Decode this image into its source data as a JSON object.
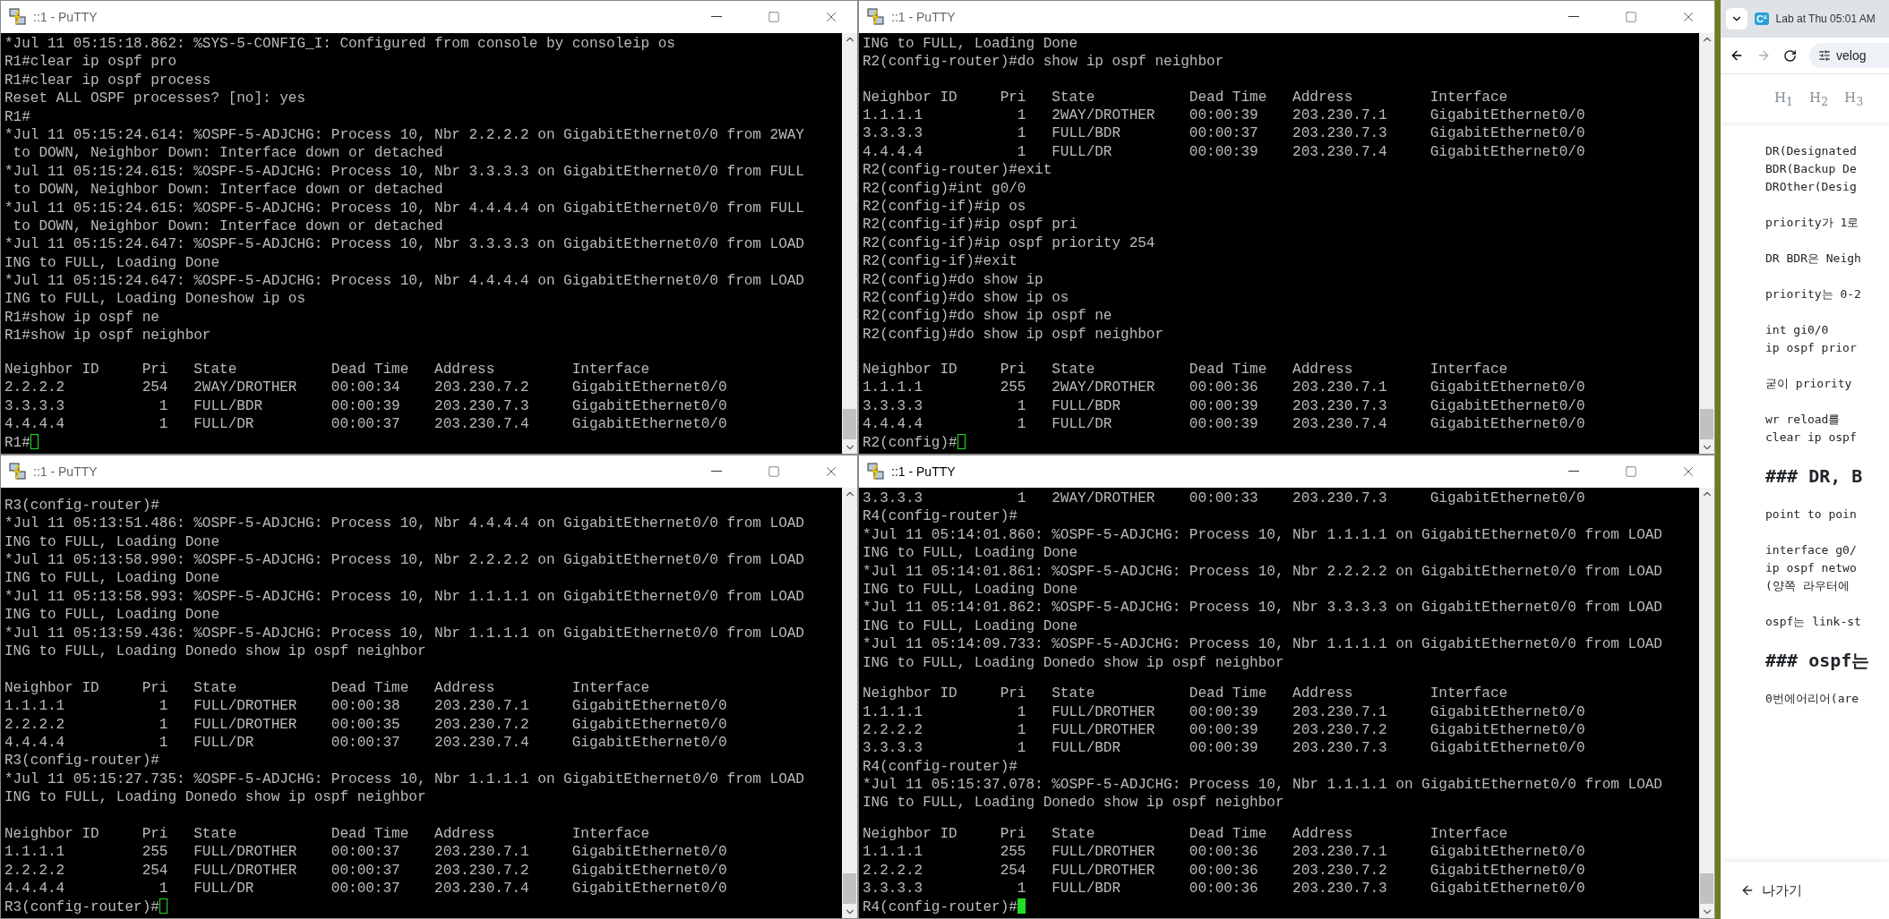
{
  "windows": [
    {
      "title": "::1 - PuTTY",
      "focused": false,
      "blocks": [
        [
          "*Jul 11 05:15:18.862: %SYS-5-CONFIG_I: Configured from console by consoleip os",
          "R1#clear ip ospf pro",
          "R1#clear ip ospf process",
          "Reset ALL OSPF processes? [no]: yes",
          "R1#",
          "*Jul 11 05:15:24.614: %OSPF-5-ADJCHG: Process 10, Nbr 2.2.2.2 on GigabitEthernet0/0 from 2WAY",
          " to DOWN, Neighbor Down: Interface down or detached",
          "*Jul 11 05:15:24.615: %OSPF-5-ADJCHG: Process 10, Nbr 3.3.3.3 on GigabitEthernet0/0 from FULL",
          " to DOWN, Neighbor Down: Interface down or detached",
          "*Jul 11 05:15:24.615: %OSPF-5-ADJCHG: Process 10, Nbr 4.4.4.4 on GigabitEthernet0/0 from FULL",
          " to DOWN, Neighbor Down: Interface down or detached",
          "*Jul 11 05:15:24.647: %OSPF-5-ADJCHG: Process 10, Nbr 3.3.3.3 on GigabitEthernet0/0 from LOAD",
          "ING to FULL, Loading Done",
          "*Jul 11 05:15:24.647: %OSPF-5-ADJCHG: Process 10, Nbr 4.4.4.4 on GigabitEthernet0/0 from LOAD",
          "ING to FULL, Loading Doneshow ip os",
          "R1#show ip ospf ne",
          "R1#show ip ospf neighbor"
        ],
        [
          "Neighbor ID     Pri   State           Dead Time   Address         Interface",
          "2.2.2.2         254   2WAY/DROTHER    00:00:34    203.230.7.2     GigabitEthernet0/0",
          "3.3.3.3           1   FULL/BDR        00:00:39    203.230.7.3     GigabitEthernet0/0",
          "4.4.4.4           1   FULL/DR         00:00:37    203.230.7.4     GigabitEthernet0/0",
          "R1#"
        ]
      ]
    },
    {
      "title": "::1 - PuTTY",
      "focused": false,
      "blocks": [
        [
          "ING to FULL, Loading Done",
          "R2(config-router)#do show ip ospf neighbor"
        ],
        [
          "Neighbor ID     Pri   State           Dead Time   Address         Interface",
          "1.1.1.1           1   2WAY/DROTHER    00:00:39    203.230.7.1     GigabitEthernet0/0",
          "3.3.3.3           1   FULL/BDR        00:00:37    203.230.7.3     GigabitEthernet0/0",
          "4.4.4.4           1   FULL/DR         00:00:39    203.230.7.4     GigabitEthernet0/0",
          "R2(config-router)#exit",
          "R2(config)#int g0/0",
          "R2(config-if)#ip os",
          "R2(config-if)#ip ospf pri",
          "R2(config-if)#ip ospf priority 254",
          "R2(config-if)#exit",
          "R2(config)#do show ip",
          "R2(config)#do show ip os",
          "R2(config)#do show ip ospf ne",
          "R2(config)#do show ip ospf neighbor"
        ],
        [
          "Neighbor ID     Pri   State           Dead Time   Address         Interface",
          "1.1.1.1         255   2WAY/DROTHER    00:00:36    203.230.7.1     GigabitEthernet0/0",
          "3.3.3.3           1   FULL/BDR        00:00:39    203.230.7.3     GigabitEthernet0/0",
          "4.4.4.4           1   FULL/DR         00:00:39    203.230.7.4     GigabitEthernet0/0",
          "R2(config)#"
        ]
      ]
    },
    {
      "title": "::1 - PuTTY",
      "focused": false,
      "blocks": [
        [
          "R3(config-router)#",
          "*Jul 11 05:13:51.486: %OSPF-5-ADJCHG: Process 10, Nbr 4.4.4.4 on GigabitEthernet0/0 from LOAD",
          "ING to FULL, Loading Done",
          "*Jul 11 05:13:58.990: %OSPF-5-ADJCHG: Process 10, Nbr 2.2.2.2 on GigabitEthernet0/0 from LOAD",
          "ING to FULL, Loading Done",
          "*Jul 11 05:13:58.993: %OSPF-5-ADJCHG: Process 10, Nbr 1.1.1.1 on GigabitEthernet0/0 from LOAD",
          "ING to FULL, Loading Done",
          "*Jul 11 05:13:59.436: %OSPF-5-ADJCHG: Process 10, Nbr 1.1.1.1 on GigabitEthernet0/0 from LOAD",
          "ING to FULL, Loading Donedo show ip ospf neighbor"
        ],
        [
          "Neighbor ID     Pri   State           Dead Time   Address         Interface",
          "1.1.1.1           1   FULL/DROTHER    00:00:38    203.230.7.1     GigabitEthernet0/0",
          "2.2.2.2           1   FULL/DROTHER    00:00:35    203.230.7.2     GigabitEthernet0/0",
          "4.4.4.4           1   FULL/DR         00:00:37    203.230.7.4     GigabitEthernet0/0",
          "R3(config-router)#",
          "*Jul 11 05:15:27.735: %OSPF-5-ADJCHG: Process 10, Nbr 1.1.1.1 on GigabitEthernet0/0 from LOAD",
          "ING to FULL, Loading Donedo show ip ospf neighbor"
        ],
        [
          "Neighbor ID     Pri   State           Dead Time   Address         Interface",
          "1.1.1.1         255   FULL/DROTHER    00:00:37    203.230.7.1     GigabitEthernet0/0",
          "2.2.2.2         254   FULL/DROTHER    00:00:37    203.230.7.2     GigabitEthernet0/0",
          "4.4.4.4           1   FULL/DR         00:00:37    203.230.7.4     GigabitEthernet0/0",
          "R3(config-router)#"
        ]
      ]
    },
    {
      "title": "::1 - PuTTY",
      "focused": true,
      "blocks": [
        [
          "3.3.3.3           1   2WAY/DROTHER    00:00:33    203.230.7.3     GigabitEthernet0/0",
          "R4(config-router)#",
          "*Jul 11 05:14:01.860: %OSPF-5-ADJCHG: Process 10, Nbr 1.1.1.1 on GigabitEthernet0/0 from LOAD",
          "ING to FULL, Loading Done",
          "*Jul 11 05:14:01.861: %OSPF-5-ADJCHG: Process 10, Nbr 2.2.2.2 on GigabitEthernet0/0 from LOAD",
          "ING to FULL, Loading Done",
          "*Jul 11 05:14:01.862: %OSPF-5-ADJCHG: Process 10, Nbr 3.3.3.3 on GigabitEthernet0/0 from LOAD",
          "ING to FULL, Loading Done",
          "*Jul 11 05:14:09.733: %OSPF-5-ADJCHG: Process 10, Nbr 1.1.1.1 on GigabitEthernet0/0 from LOAD",
          "ING to FULL, Loading Donedo show ip ospf neighbor"
        ],
        [
          "Neighbor ID     Pri   State           Dead Time   Address         Interface",
          "1.1.1.1           1   FULL/DROTHER    00:00:39    203.230.7.1     GigabitEthernet0/0",
          "2.2.2.2           1   FULL/DROTHER    00:00:39    203.230.7.2     GigabitEthernet0/0",
          "3.3.3.3           1   FULL/BDR        00:00:39    203.230.7.3     GigabitEthernet0/0",
          "R4(config-router)#",
          "*Jul 11 05:15:37.078: %OSPF-5-ADJCHG: Process 10, Nbr 1.1.1.1 on GigabitEthernet0/0 from LOAD",
          "ING to FULL, Loading Donedo show ip ospf neighbor"
        ],
        [
          "Neighbor ID     Pri   State           Dead Time   Address         Interface",
          "1.1.1.1         255   FULL/DROTHER    00:00:36    203.230.7.1     GigabitEthernet0/0",
          "2.2.2.2         254   FULL/DROTHER    00:00:36    203.230.7.2     GigabitEthernet0/0",
          "3.3.3.3           1   FULL/BDR        00:00:36    203.230.7.3     GigabitEthernet0/0",
          "R4(config-router)#"
        ]
      ]
    }
  ],
  "browser": {
    "tab": {
      "favicon": "C²",
      "title": "Lab at Thu 05:01 AM"
    },
    "url": "velog",
    "forward_disabled": true,
    "editor_toolbar": [
      "H$_{1}$",
      "H$_{2}$",
      "H$_{3}$"
    ],
    "content": [
      {
        "kind": "text",
        "lines": [
          "DR(Designated",
          "BDR(Backup De",
          "DROther(Desig"
        ]
      },
      {
        "kind": "text",
        "lines": [
          "priority가 1로"
        ]
      },
      {
        "kind": "text",
        "lines": [
          "DR BDR은 Neigh"
        ]
      },
      {
        "kind": "text",
        "lines": [
          "priority는 0-2"
        ]
      },
      {
        "kind": "text",
        "lines": [
          "int gi0/0",
          "ip ospf prior"
        ]
      },
      {
        "kind": "text",
        "lines": [
          "굳이 priority"
        ]
      },
      {
        "kind": "text",
        "lines": [
          "wr reload를",
          "clear ip ospf"
        ]
      },
      {
        "kind": "heading",
        "lines": [
          "### DR, B"
        ]
      },
      {
        "kind": "text",
        "lines": [
          "point to poin"
        ]
      },
      {
        "kind": "text",
        "lines": [
          "interface g0/",
          "ip ospf netwo",
          "(양쪽 라우터에"
        ]
      },
      {
        "kind": "text",
        "lines": [
          "ospf는 link-st"
        ]
      },
      {
        "kind": "heading",
        "lines": [
          "### ospf는"
        ]
      },
      {
        "kind": "text",
        "lines": [
          "0번에어리어(are"
        ]
      }
    ],
    "exit_button": "나가기"
  }
}
